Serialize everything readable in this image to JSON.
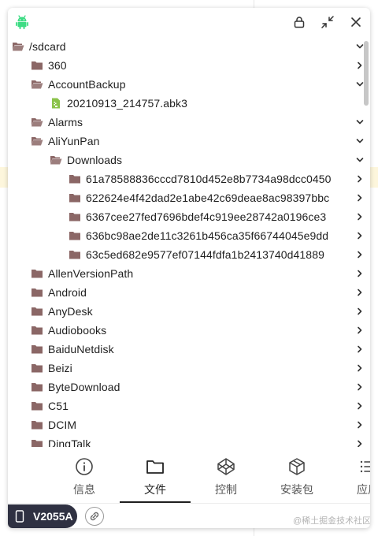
{
  "window": {
    "icons": [
      "android-icon",
      "lock-icon",
      "shrink-icon",
      "close-icon"
    ]
  },
  "colors": {
    "folder": "#8b6766",
    "folder_open": "#8b6766",
    "apk_file": "#8bc34a",
    "android": "#3ddc84",
    "nav_active_underline": "#1f1f1f",
    "device_pill": "#2f3142"
  },
  "tree": [
    {
      "label": "/sdcard",
      "level": 0,
      "type": "folder-open",
      "expanded": true
    },
    {
      "label": "360",
      "level": 1,
      "type": "folder",
      "expanded": false
    },
    {
      "label": "AccountBackup",
      "level": 1,
      "type": "folder-open",
      "expanded": true
    },
    {
      "label": "20210913_214757.abk3",
      "level": 2,
      "type": "file"
    },
    {
      "label": "Alarms",
      "level": 1,
      "type": "folder-open",
      "expanded": true
    },
    {
      "label": "AliYunPan",
      "level": 1,
      "type": "folder-open",
      "expanded": true
    },
    {
      "label": "Downloads",
      "level": 2,
      "type": "folder-open",
      "expanded": true
    },
    {
      "label": "61a78588836cccd7810d452e8b7734a98dcc0450",
      "level": 3,
      "type": "folder",
      "expanded": false
    },
    {
      "label": "622624e4f42dad2e1abe42c69deae8ac98397bbc",
      "level": 3,
      "type": "folder",
      "expanded": false
    },
    {
      "label": "6367cee27fed7696bdef4c919ee28742a0196ce3",
      "level": 3,
      "type": "folder",
      "expanded": false
    },
    {
      "label": "636bc98ae2de11c3261b456ca35f66744045e9dd",
      "level": 3,
      "type": "folder",
      "expanded": false
    },
    {
      "label": "63c5ed682e9577ef07144fdfa1b2413740d41889",
      "level": 3,
      "type": "folder",
      "expanded": false
    },
    {
      "label": "AllenVersionPath",
      "level": 1,
      "type": "folder",
      "expanded": false
    },
    {
      "label": "Android",
      "level": 1,
      "type": "folder",
      "expanded": false
    },
    {
      "label": "AnyDesk",
      "level": 1,
      "type": "folder",
      "expanded": false
    },
    {
      "label": "Audiobooks",
      "level": 1,
      "type": "folder",
      "expanded": false
    },
    {
      "label": "BaiduNetdisk",
      "level": 1,
      "type": "folder",
      "expanded": false
    },
    {
      "label": "Beizi",
      "level": 1,
      "type": "folder",
      "expanded": false
    },
    {
      "label": "ByteDownload",
      "level": 1,
      "type": "folder",
      "expanded": false
    },
    {
      "label": "C51",
      "level": 1,
      "type": "folder",
      "expanded": false
    },
    {
      "label": "DCIM",
      "level": 1,
      "type": "folder",
      "expanded": false
    },
    {
      "label": "DingTalk",
      "level": 1,
      "type": "folder",
      "expanded": false
    }
  ],
  "nav": [
    {
      "label": "信息",
      "icon": "info-icon",
      "active": false
    },
    {
      "label": "文件",
      "icon": "folder-outline-icon",
      "active": true
    },
    {
      "label": "控制",
      "icon": "codepen-icon",
      "active": false
    },
    {
      "label": "安装包",
      "icon": "package-icon",
      "active": false
    },
    {
      "label": "应用",
      "icon": "list-icon",
      "active": false
    }
  ],
  "footer": {
    "device_name": "V2055A",
    "watermark": "@稀土掘金技术社区"
  }
}
